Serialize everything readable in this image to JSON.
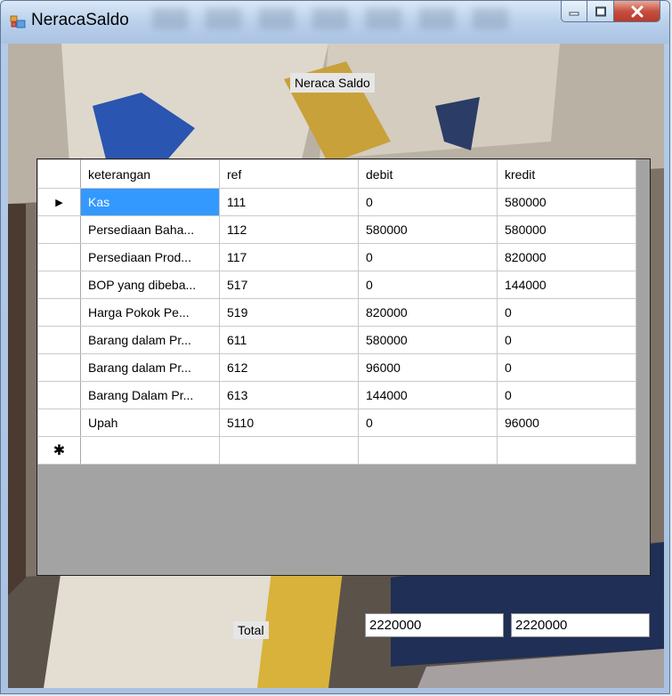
{
  "window": {
    "title": "NeracaSaldo"
  },
  "form": {
    "heading": "Neraca Saldo"
  },
  "grid": {
    "columns": [
      "keterangan",
      "ref",
      "debit",
      "kredit"
    ],
    "rows": [
      {
        "keterangan": "Kas",
        "ref": "111",
        "debit": "0",
        "kredit": "580000"
      },
      {
        "keterangan": "Persediaan Baha...",
        "ref": "112",
        "debit": "580000",
        "kredit": "580000"
      },
      {
        "keterangan": "Persediaan Prod...",
        "ref": "117",
        "debit": "0",
        "kredit": "820000"
      },
      {
        "keterangan": "BOP yang dibeba...",
        "ref": "517",
        "debit": "0",
        "kredit": "144000"
      },
      {
        "keterangan": "Harga Pokok Pe...",
        "ref": "519",
        "debit": "820000",
        "kredit": "0"
      },
      {
        "keterangan": "Barang dalam Pr...",
        "ref": "611",
        "debit": "580000",
        "kredit": "0"
      },
      {
        "keterangan": "Barang dalam Pr...",
        "ref": "612",
        "debit": "96000",
        "kredit": "0"
      },
      {
        "keterangan": "Barang Dalam Pr...",
        "ref": "613",
        "debit": "144000",
        "kredit": "0"
      },
      {
        "keterangan": "Upah",
        "ref": "5110",
        "debit": "0",
        "kredit": "96000"
      }
    ],
    "current_row_marker": "▶",
    "new_row_marker": "✱"
  },
  "totals": {
    "label": "Total",
    "debit": "2220000",
    "kredit": "2220000"
  },
  "colors": {
    "selection": "#3399ff",
    "grid_background": "#a3a3a3",
    "close_button": "#c75040"
  }
}
